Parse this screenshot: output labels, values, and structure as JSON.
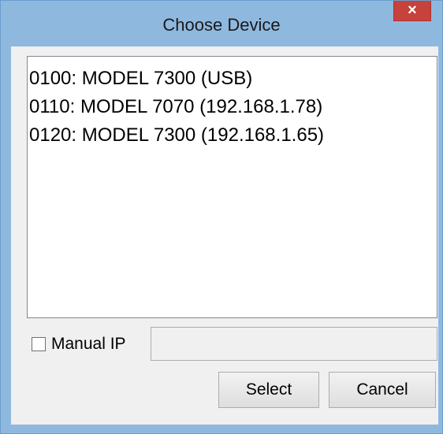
{
  "window": {
    "title": "Choose Device",
    "close_label": "×"
  },
  "devices": [
    "0100: MODEL 7300 (USB)",
    "0110: MODEL 7070 (192.168.1.78)",
    "0120: MODEL 7300 (192.168.1.65)"
  ],
  "manual_ip": {
    "checkbox_label": "Manual IP",
    "checked": false,
    "value": ""
  },
  "buttons": {
    "select_label": "Select",
    "cancel_label": "Cancel"
  },
  "colors": {
    "frame": "#8fb8df",
    "close": "#c7423a",
    "client": "#f0f0f0"
  }
}
